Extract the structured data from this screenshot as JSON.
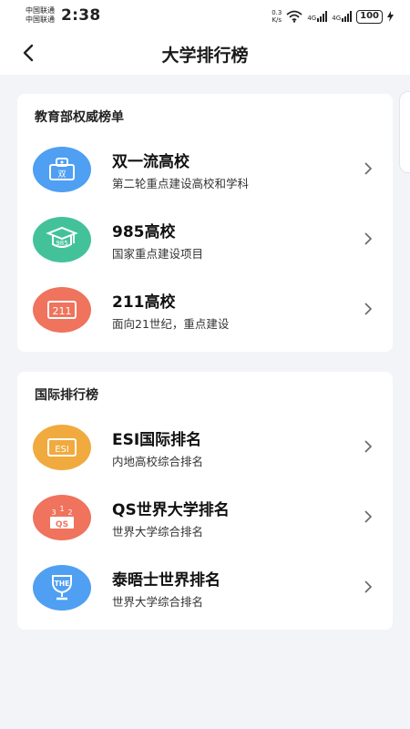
{
  "status_bar": {
    "carrier1": "中国联通",
    "carrier2": "中国联通",
    "time": "2:38",
    "net_speed_value": "0.3",
    "net_speed_unit": "K/s",
    "signal1_label": "4G",
    "signal2_label": "4G",
    "battery": "100"
  },
  "header": {
    "title": "大学排行榜"
  },
  "sections": [
    {
      "title": "教育部权威榜单",
      "items": [
        {
          "title": "双一流高校",
          "subtitle": "第二轮重点建设高校和学科",
          "icon": "double-first-class-icon",
          "color": "#4f9ff2",
          "icon_text": "双"
        },
        {
          "title": "985高校",
          "subtitle": "国家重点建设项目",
          "icon": "graduation-cap-icon",
          "color": "#43c29a",
          "icon_text": "985"
        },
        {
          "title": "211高校",
          "subtitle": "面向21世纪，重点建设",
          "icon": "badge-211-icon",
          "color": "#ef735d",
          "icon_text": "211"
        }
      ]
    },
    {
      "title": "国际排行榜",
      "items": [
        {
          "title": "ESI国际排名",
          "subtitle": "内地高校综合排名",
          "icon": "esi-badge-icon",
          "color": "#f1aa3e",
          "icon_text": "ESI"
        },
        {
          "title": "QS世界大学排名",
          "subtitle": "世界大学综合排名",
          "icon": "qs-podium-icon",
          "color": "#ef735d",
          "icon_text": "QS"
        },
        {
          "title": "泰晤士世界排名",
          "subtitle": "世界大学综合排名",
          "icon": "the-trophy-icon",
          "color": "#4f9ff2",
          "icon_text": "THE"
        }
      ]
    }
  ]
}
